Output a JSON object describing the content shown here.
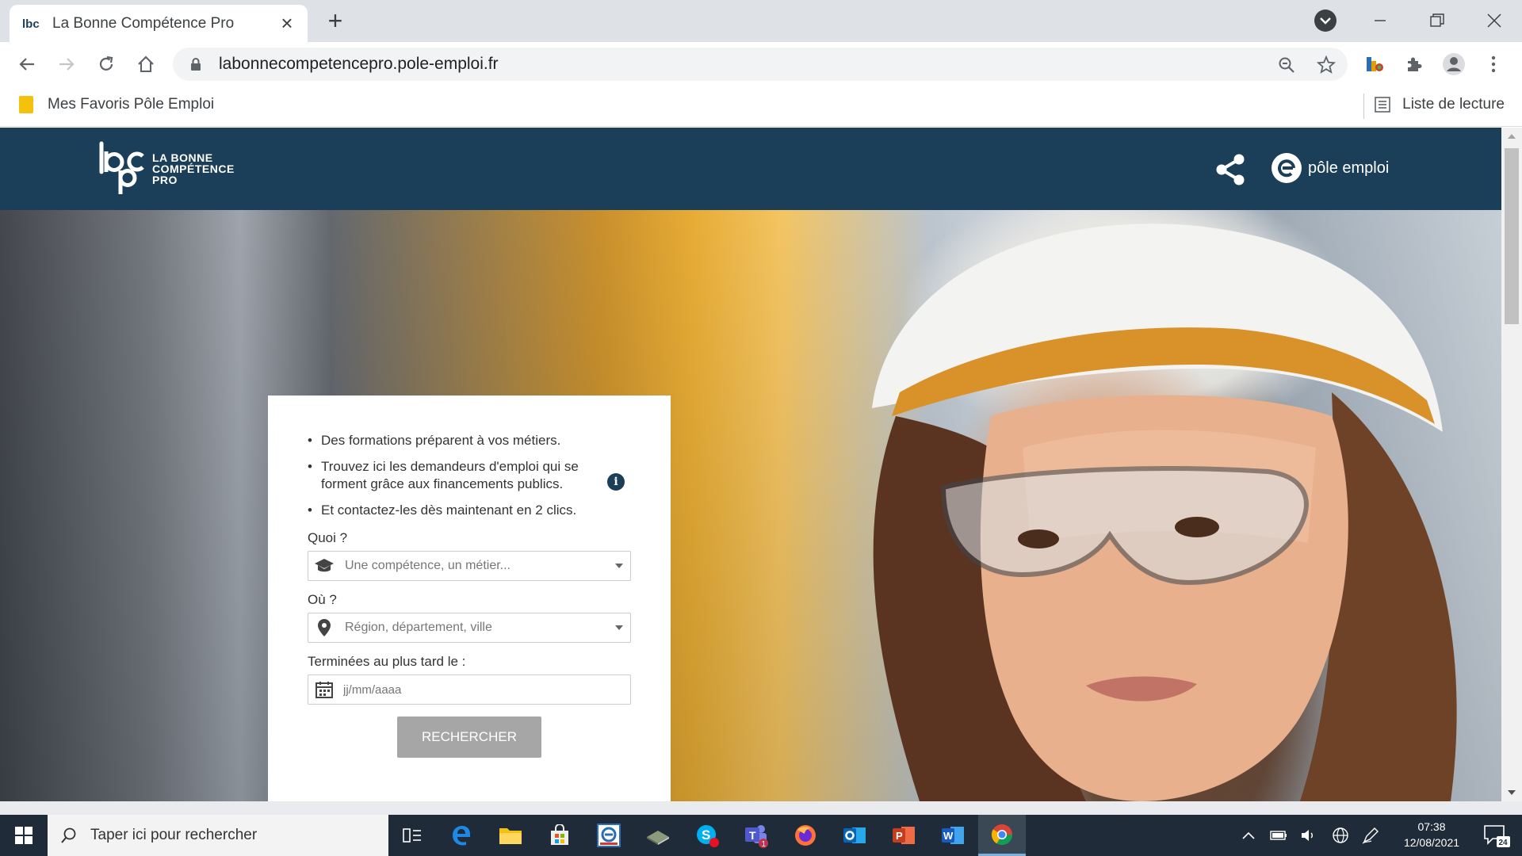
{
  "browser": {
    "tab_title": "La Bonne Compétence Pro",
    "url": "labonnecompetencepro.pole-emploi.fr",
    "bookmark_label": "Mes Favoris Pôle Emploi",
    "reading_list_label": "Liste de lecture"
  },
  "site": {
    "logo_text_line1": "LA BONNE",
    "logo_text_line2": "COMPÉTENCE",
    "logo_text_line3": "PRO",
    "pe_brand": "pôle emploi"
  },
  "search_card": {
    "bullets": [
      "Des formations préparent à vos métiers.",
      "Trouvez ici les demandeurs d'emploi qui se forment grâce aux financements publics.",
      "Et contactez-les dès maintenant en 2 clics."
    ],
    "info_glyph": "i",
    "quoi_label": "Quoi ?",
    "quoi_placeholder": "Une compétence, un métier...",
    "ou_label": "Où ?",
    "ou_placeholder": "Région, département, ville",
    "date_label": "Terminées au plus tard le :",
    "date_placeholder": "jj/mm/aaaa",
    "submit_label": "RECHERCHER"
  },
  "taskbar": {
    "search_placeholder": "Taper ici pour rechercher",
    "time": "07:38",
    "date": "12/08/2021",
    "notification_count": "24",
    "teams_badge": "1"
  },
  "colors": {
    "header_bg": "#1c3f59",
    "button_disabled": "#a6a6a6",
    "taskbar_bg": "#1f2b38"
  }
}
